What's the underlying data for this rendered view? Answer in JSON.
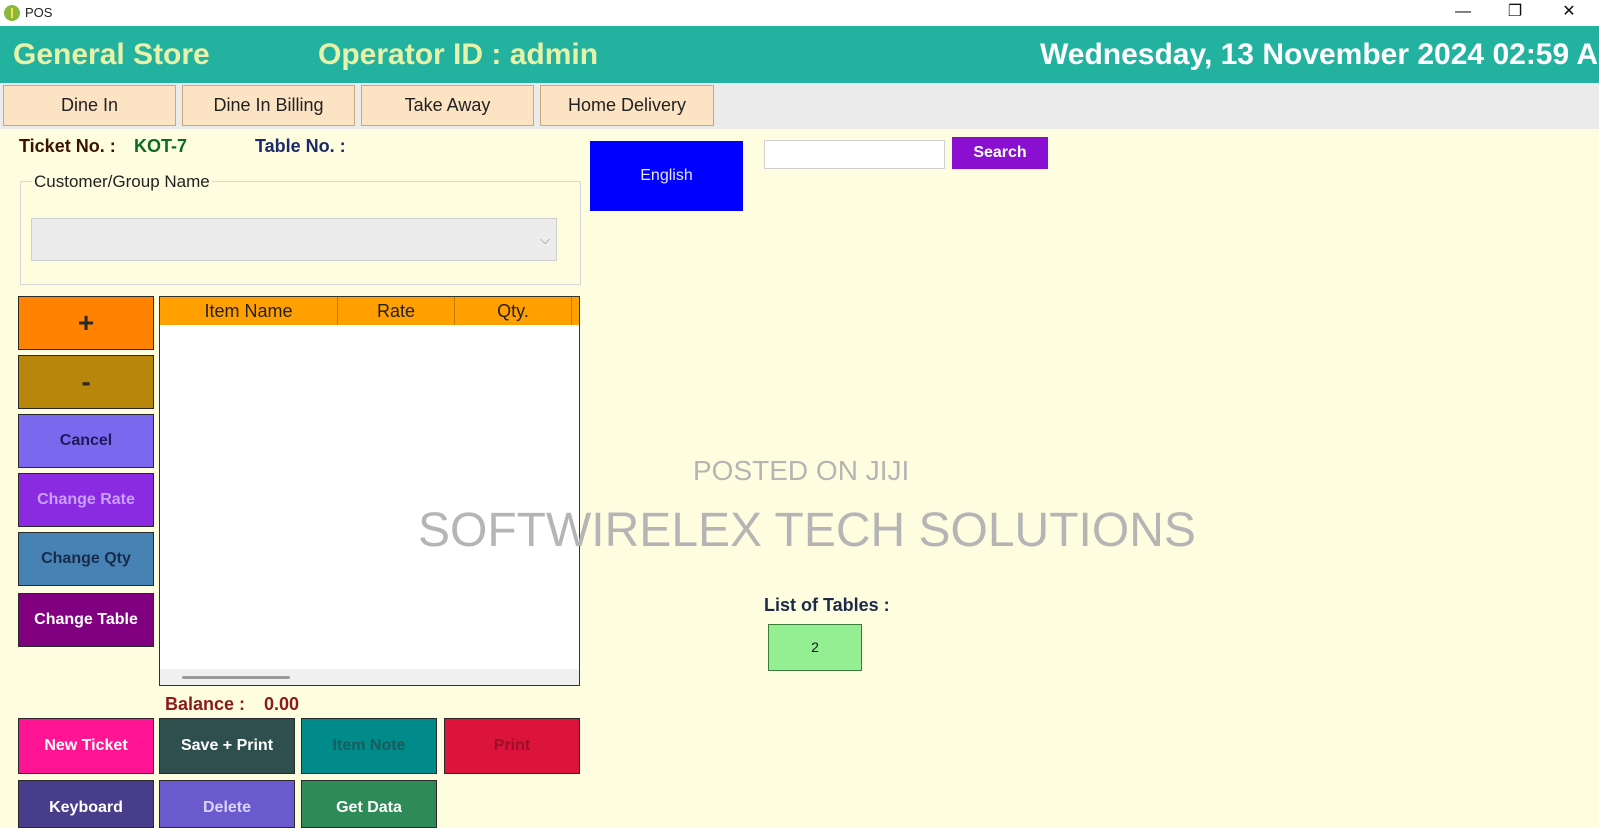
{
  "window": {
    "title": "POS",
    "minimize": "—",
    "maximize": "❐",
    "close": "✕"
  },
  "header": {
    "store_name": "General Store",
    "operator": "Operator ID :  admin",
    "datetime": "Wednesday, 13 November 2024 02:59 A"
  },
  "tabs": [
    {
      "label": "Dine In"
    },
    {
      "label": "Dine In Billing"
    },
    {
      "label": "Take Away"
    },
    {
      "label": "Home Delivery"
    }
  ],
  "ticket": {
    "ticket_label": "Ticket No. :",
    "ticket_value": "KOT-7",
    "table_label": "Table No. :"
  },
  "customer": {
    "group_label": "Customer/Group Name",
    "selected": ""
  },
  "language_button": "English",
  "search": {
    "value": "",
    "button": "Search"
  },
  "side_buttons": {
    "plus": "+",
    "minus": "-",
    "cancel": "Cancel",
    "change_rate": "Change Rate",
    "change_qty": "Change Qty",
    "change_table": "Change Table"
  },
  "grid": {
    "columns": [
      "Item Name",
      "Rate",
      "Qty."
    ],
    "rows": []
  },
  "balance": {
    "label": "Balance :",
    "value": "0.00"
  },
  "bottom_buttons": {
    "new_ticket": "New Ticket",
    "save_print": "Save + Print",
    "item_note": "Item Note",
    "print": "Print",
    "keyboard": "Keyboard",
    "delete": "Delete",
    "get_data": "Get Data"
  },
  "tables": {
    "label": "List of Tables :",
    "items": [
      "2"
    ]
  },
  "watermark": {
    "line1": "POSTED ON JIJI",
    "line2": "SOFTWIRELEX TECH SOLUTIONS"
  }
}
